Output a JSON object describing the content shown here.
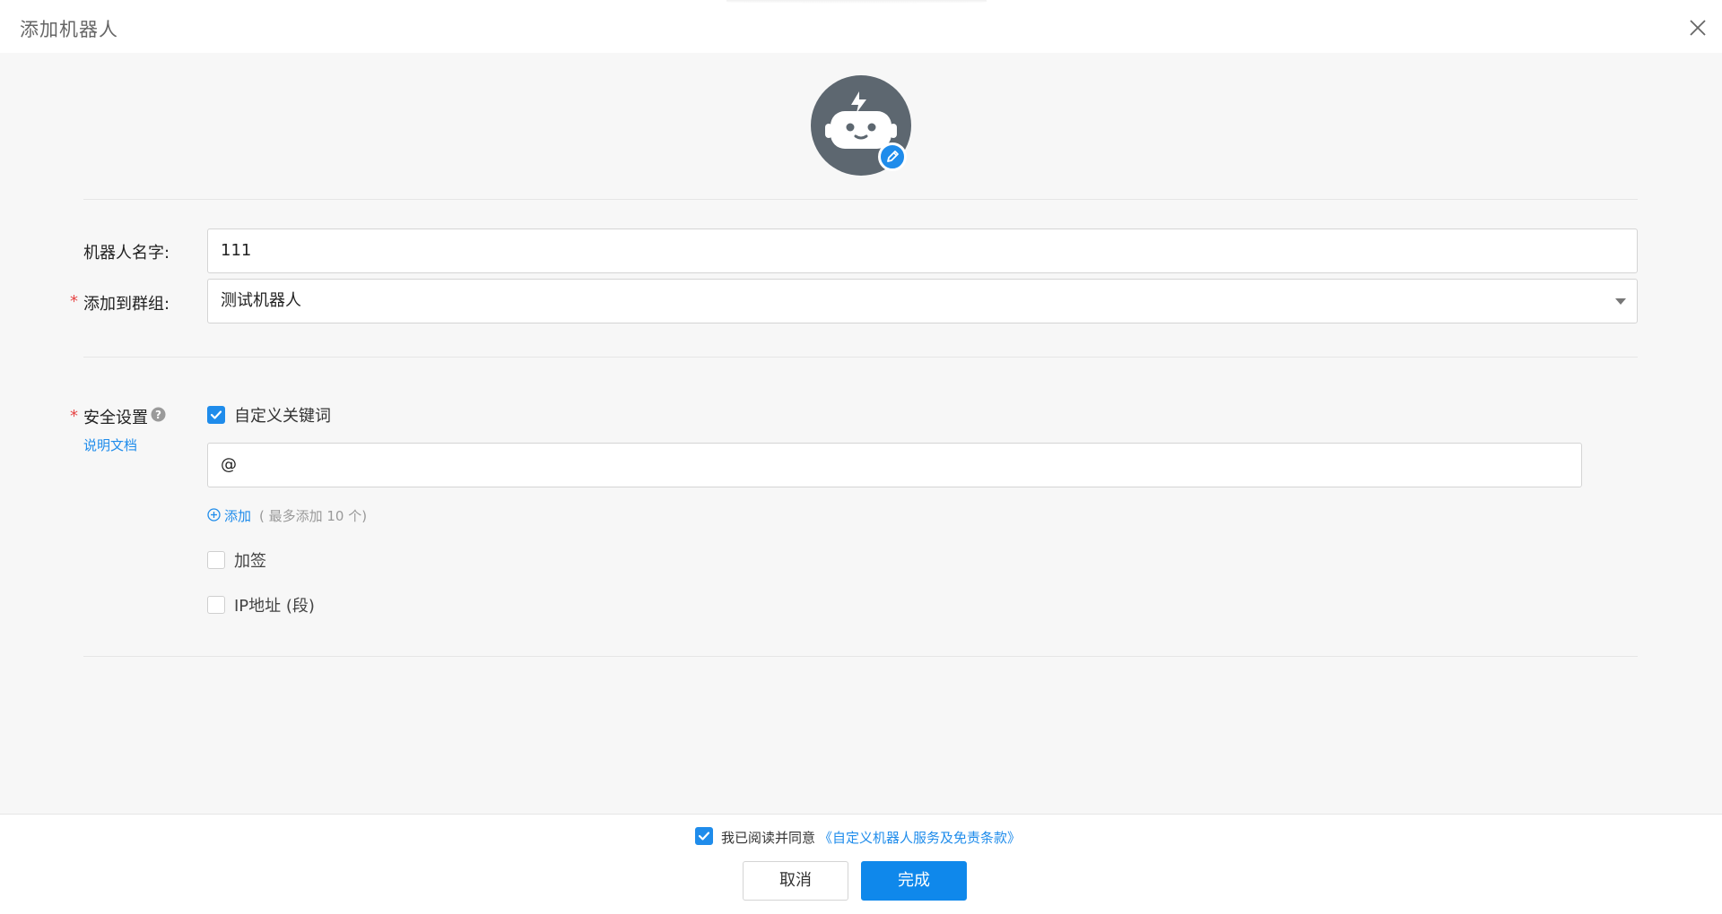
{
  "dialog": {
    "title": "添加机器人",
    "close_icon": "close-icon"
  },
  "avatar": {
    "icon": "robot-icon",
    "edit_icon": "pencil-icon",
    "background_color": "#5d6770",
    "badge_color": "#1f8ceb"
  },
  "form": {
    "name_label": "机器人名字:",
    "name_value": "111",
    "group_required": "*",
    "group_label": "添加到群组:",
    "group_value": "测试机器人",
    "security_required": "*",
    "security_label": "安全设置",
    "help_icon": "question-circle-icon",
    "doc_link": "说明文档",
    "keyword_option": {
      "label": "自定义关键词",
      "checked": true
    },
    "keyword_value": "@",
    "add_label": "添加",
    "add_hint": "( 最多添加 10 个)",
    "sign_option": {
      "label": "加签",
      "checked": false
    },
    "ip_option": {
      "label": "IP地址 (段)",
      "checked": false
    }
  },
  "footer": {
    "agree_checked": true,
    "agree_text": "我已阅读并同意",
    "agree_link": "《自定义机器人服务及免责条款》",
    "cancel_label": "取消",
    "ok_label": "完成"
  },
  "colors": {
    "accent": "#1f8ceb",
    "required": "#e64545"
  }
}
